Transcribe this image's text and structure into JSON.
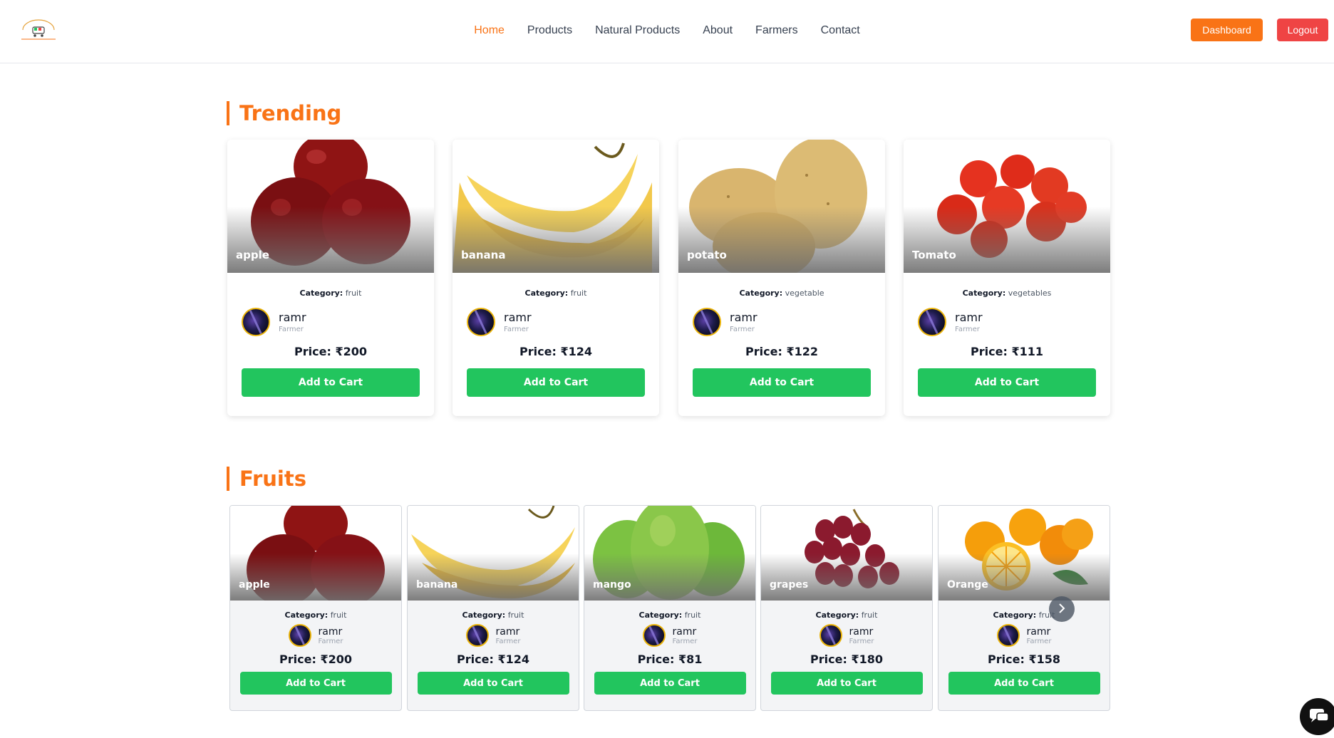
{
  "header": {
    "nav": [
      {
        "label": "Home",
        "active": true
      },
      {
        "label": "Products",
        "active": false
      },
      {
        "label": "Natural Products",
        "active": false
      },
      {
        "label": "About",
        "active": false
      },
      {
        "label": "Farmers",
        "active": false
      },
      {
        "label": "Contact",
        "active": false
      }
    ],
    "dashboard_label": "Dashboard",
    "logout_label": "Logout"
  },
  "colors": {
    "accent": "#f97316",
    "cart": "#22c55e",
    "logout": "#ef4444"
  },
  "trending": {
    "title": "Trending",
    "items": [
      {
        "name": "apple",
        "category_label": "Category:",
        "category": "fruit",
        "farmer": "ramr",
        "role": "Farmer",
        "price": "Price: ₹200",
        "cart_label": "Add to Cart",
        "image": "apple-image"
      },
      {
        "name": "banana",
        "category_label": "Category:",
        "category": "fruit",
        "farmer": "ramr",
        "role": "Farmer",
        "price": "Price: ₹124",
        "cart_label": "Add to Cart",
        "image": "banana-image"
      },
      {
        "name": "potato",
        "category_label": "Category:",
        "category": "vegetable",
        "farmer": "ramr",
        "role": "Farmer",
        "price": "Price: ₹122",
        "cart_label": "Add to Cart",
        "image": "potato-image"
      },
      {
        "name": "Tomato",
        "category_label": "Category:",
        "category": "vegetables",
        "farmer": "ramr",
        "role": "Farmer",
        "price": "Price: ₹111",
        "cart_label": "Add to Cart",
        "image": "tomato-image"
      }
    ]
  },
  "fruits": {
    "title": "Fruits",
    "items": [
      {
        "name": "apple",
        "category_label": "Category:",
        "category": "fruit",
        "farmer": "ramr",
        "role": "Farmer",
        "price": "Price: ₹200",
        "cart_label": "Add to Cart",
        "image": "apple-image"
      },
      {
        "name": "banana",
        "category_label": "Category:",
        "category": "fruit",
        "farmer": "ramr",
        "role": "Farmer",
        "price": "Price: ₹124",
        "cart_label": "Add to Cart",
        "image": "banana-image"
      },
      {
        "name": "mango",
        "category_label": "Category:",
        "category": "fruit",
        "farmer": "ramr",
        "role": "Farmer",
        "price": "Price: ₹81",
        "cart_label": "Add to Cart",
        "image": "mango-image"
      },
      {
        "name": "grapes",
        "category_label": "Category:",
        "category": "fruit",
        "farmer": "ramr",
        "role": "Farmer",
        "price": "Price: ₹180",
        "cart_label": "Add to Cart",
        "image": "grapes-image"
      },
      {
        "name": "Orange",
        "category_label": "Category:",
        "category": "fruit",
        "farmer": "ramr",
        "role": "Farmer",
        "price": "Price: ₹158",
        "cart_label": "Add to Cart",
        "image": "orange-image"
      }
    ]
  }
}
